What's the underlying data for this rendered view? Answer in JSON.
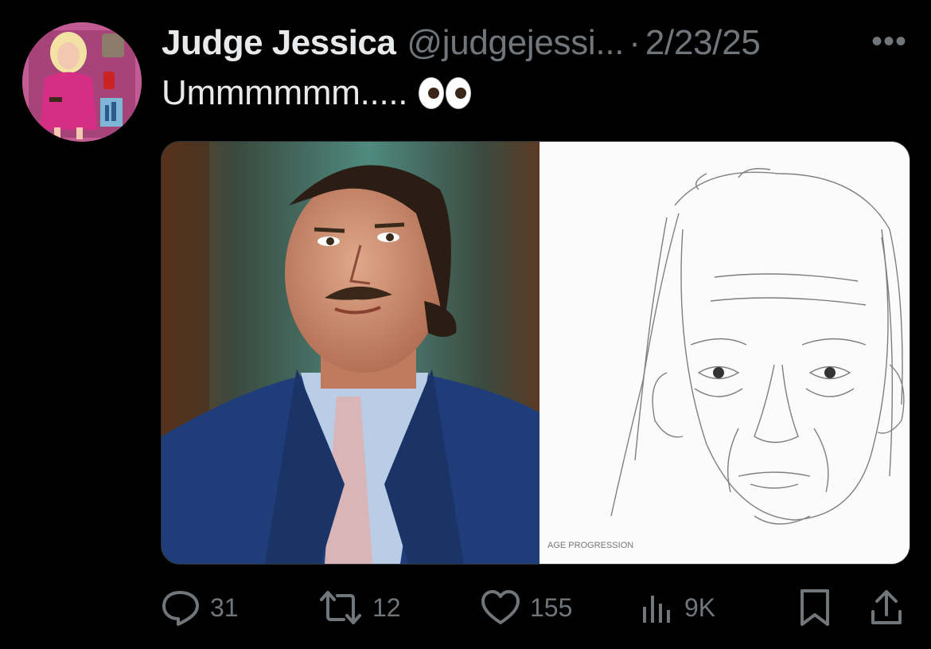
{
  "tweet": {
    "display_name": "Judge Jessica",
    "handle": "@judgejessi...",
    "separator": "·",
    "date": "2/23/25",
    "more_label": "•••",
    "text": "Ummmmmm.....",
    "emoji": "eyes-emoji",
    "avatar": "barbie-doll-avatar"
  },
  "media": {
    "left_image": "man-in-blue-suit-photo",
    "right_image": "pencil-sketch-portrait",
    "sketch_caption": "AGE PROGRESSION"
  },
  "actions": {
    "replies": "31",
    "reposts": "12",
    "likes": "155",
    "views": "9K"
  },
  "colors": {
    "background": "#000000",
    "text": "#e7e9ea",
    "secondary": "#71767b"
  }
}
